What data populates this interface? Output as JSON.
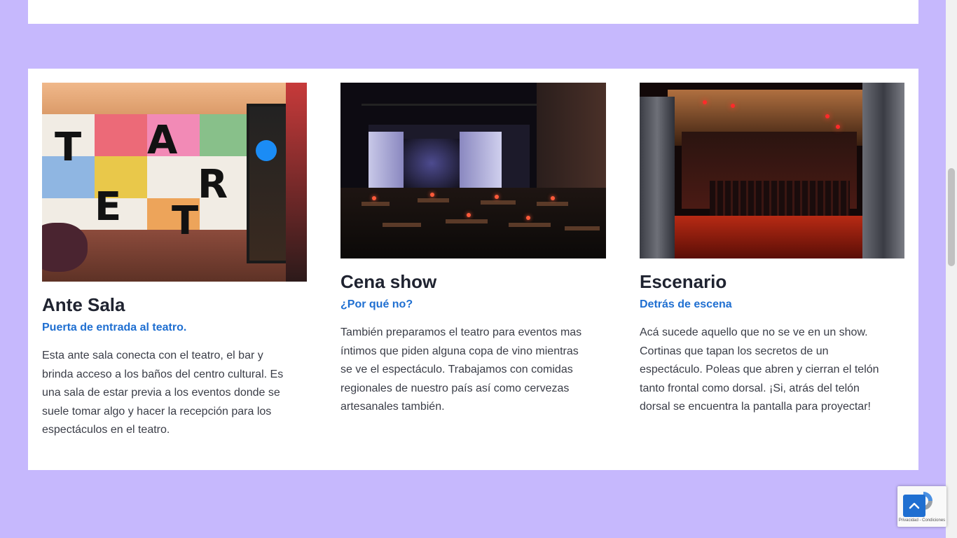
{
  "cards": [
    {
      "title": "Ante Sala",
      "subtitle": "Puerta de entrada al teatro.",
      "description": "Esta ante sala conecta con el teatro, el bar y brinda acceso a los baños del centro cultural. Es una sala de estar previa a los eventos donde se suele tomar algo y hacer la recepción para los espectáculos en el teatro.",
      "image_letters": [
        "T",
        "E",
        "A",
        "T",
        "R",
        "O"
      ]
    },
    {
      "title": "Cena show",
      "subtitle": "¿Por qué no?",
      "description": "También preparamos el teatro para eventos mas íntimos que piden alguna copa de vino mientras se ve el espectáculo. Trabajamos con comidas regionales de nuestro país así como cervezas artesanales también."
    },
    {
      "title": "Escenario",
      "subtitle": "Detrás de escena",
      "description": "Acá sucede aquello que no se ve en un show. Cortinas que tapan los secretos de un espectáculo. Poleas que abren y cierran el telón tanto frontal como dorsal. ¡Si, atrás del telón dorsal se encuentra la pantalla para proyectar!"
    }
  ],
  "recaptcha": {
    "label": "Privacidad - Condiciones"
  },
  "back_to_top": {
    "icon": "chevron-up-icon"
  },
  "colors": {
    "page_background": "#c6b8fd",
    "panel_background": "#ffffff",
    "title": "#1f2330",
    "subtitle": "#1f6fd1",
    "body_text": "#3a3d47",
    "button": "#1f6fd1"
  }
}
